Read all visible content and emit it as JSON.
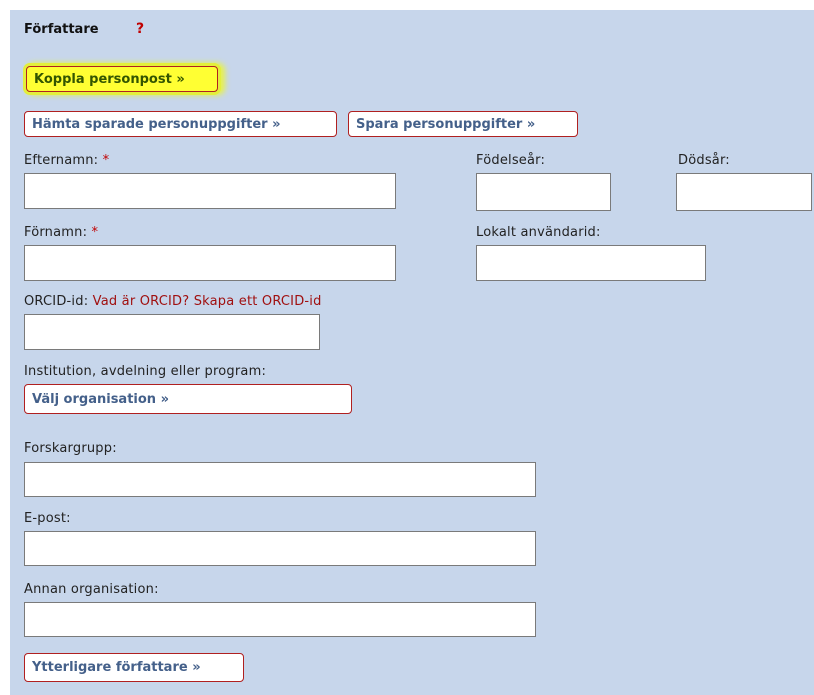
{
  "section": {
    "title": "Författare",
    "help_label": "?"
  },
  "buttons": {
    "link_person_record": "Koppla personpost »",
    "fetch_saved": "Hämta sparade personuppgifter »",
    "save_person": "Spara personuppgifter »",
    "choose_org": "Välj organisation »",
    "more_authors": "Ytterligare författare »"
  },
  "fields": {
    "last_name": {
      "label": "Efternamn:",
      "required_mark": "*",
      "value": ""
    },
    "birth_year": {
      "label": "Födelseår:",
      "value": ""
    },
    "death_year": {
      "label": "Dödsår:",
      "value": ""
    },
    "first_name": {
      "label": "Förnamn:",
      "required_mark": "*",
      "value": ""
    },
    "local_user_id": {
      "label": "Lokalt användarid:",
      "value": ""
    },
    "orcid": {
      "label": "ORCID-id:",
      "what_link": "Vad är ORCID?",
      "create_link": "Skapa ett ORCID-id",
      "value": ""
    },
    "institution": {
      "label": "Institution, avdelning eller program:"
    },
    "research_group": {
      "label": "Forskargrupp:",
      "value": ""
    },
    "email": {
      "label": "E-post:",
      "value": ""
    },
    "other_org": {
      "label": "Annan organisation:",
      "value": ""
    }
  },
  "colors": {
    "panel_background": "#c7d6eb",
    "button_border": "#b02020",
    "highlight": "#ffff33",
    "required_mark": "#c00000"
  }
}
